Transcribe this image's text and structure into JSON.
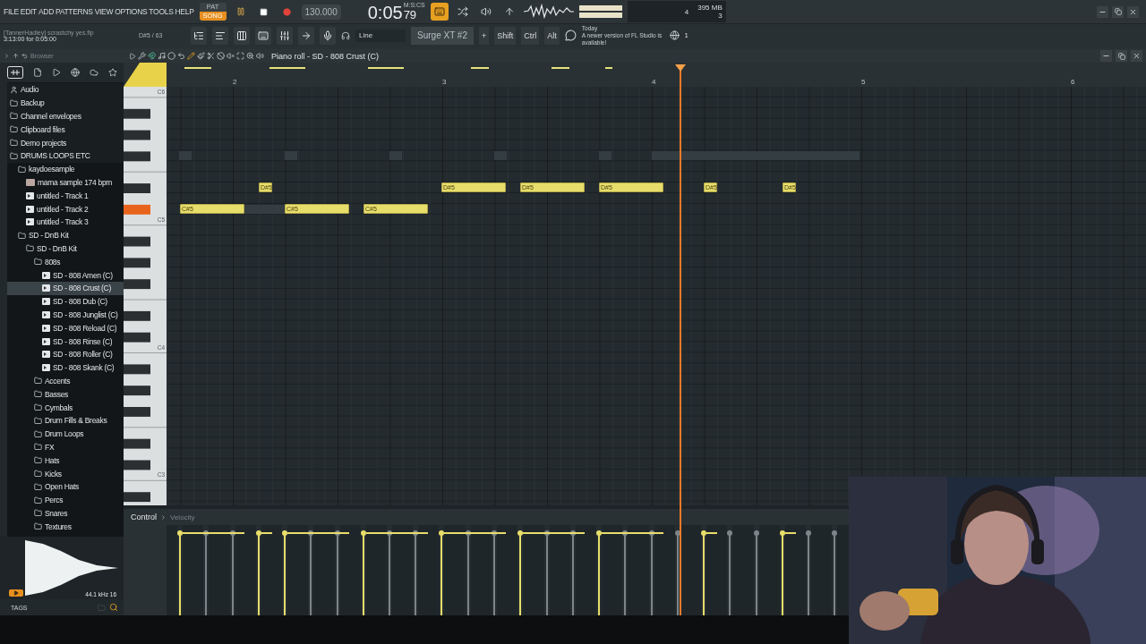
{
  "menu": [
    "FILE",
    "EDIT",
    "ADD",
    "PATTERNS",
    "VIEW",
    "OPTIONS",
    "TOOLS",
    "HELP"
  ],
  "transport": {
    "modes": [
      {
        "label": "PAT",
        "selected": false
      },
      {
        "label": "SONG",
        "selected": true
      }
    ],
    "tempo": "130.000",
    "time": "0:05",
    "time_fraction": "79",
    "time_unit": "M:S:CS"
  },
  "monitor": {
    "voices": "4",
    "memory": "395 MB",
    "cpu": "3"
  },
  "project": {
    "title": "[TannerHadley] scrastchy yes.flp",
    "position": "3:13:00 for 0:05:00",
    "note_info": "D#5 / 63"
  },
  "toolbar": {
    "recording_source": "Line",
    "channel": "Surge XT #2",
    "channel_add": "+",
    "modifiers": [
      "Shift",
      "Ctrl",
      "Alt"
    ],
    "hint_title": "Today",
    "hint": "A newer version of FL Studio is available!",
    "notification_count": "1"
  },
  "browser": {
    "title": "Browser",
    "tree": [
      {
        "label": "Audio",
        "kind": "user",
        "selected": false
      },
      {
        "label": "Backup",
        "kind": "folder",
        "selected": false
      },
      {
        "label": "Channel envelopes",
        "kind": "folder",
        "selected": false
      },
      {
        "label": "Clipboard files",
        "kind": "folder",
        "selected": false
      },
      {
        "label": "Demo projects",
        "kind": "folder",
        "selected": false
      },
      {
        "label": "DRUMS LOOPS ETC",
        "kind": "folder",
        "selected": false,
        "children": [
          {
            "label": "kaydoesample",
            "kind": "folder",
            "selected": false,
            "children": [
              {
                "label": "mama sample 174 bpm",
                "kind": "audio",
                "selected": false
              },
              {
                "label": "untitled - Track 1",
                "kind": "sample",
                "selected": false
              },
              {
                "label": "untitled - Track 2",
                "kind": "sample",
                "selected": false
              },
              {
                "label": "untitled - Track 3",
                "kind": "sample",
                "selected": false
              }
            ]
          },
          {
            "label": "SD - DnB Kit",
            "kind": "folder",
            "selected": false,
            "children": [
              {
                "label": "SD - DnB Kit",
                "kind": "folder",
                "selected": false,
                "children": [
                  {
                    "label": "808s",
                    "kind": "folder",
                    "selected": false,
                    "children": [
                      {
                        "label": "SD - 808 Amen (C)",
                        "kind": "sample",
                        "selected": false
                      },
                      {
                        "label": "SD - 808 Crust (C)",
                        "kind": "sample",
                        "selected": true
                      },
                      {
                        "label": "SD - 808 Dub (C)",
                        "kind": "sample",
                        "selected": false
                      },
                      {
                        "label": "SD - 808 Junglist (C)",
                        "kind": "sample",
                        "selected": false
                      },
                      {
                        "label": "SD - 808 Reload (C)",
                        "kind": "sample",
                        "selected": false
                      },
                      {
                        "label": "SD - 808 Rinse (C)",
                        "kind": "sample",
                        "selected": false
                      },
                      {
                        "label": "SD - 808 Roller (C)",
                        "kind": "sample",
                        "selected": false
                      },
                      {
                        "label": "SD - 808 Skank (C)",
                        "kind": "sample",
                        "selected": false
                      }
                    ]
                  },
                  {
                    "label": "Accents",
                    "kind": "folder",
                    "selected": false
                  },
                  {
                    "label": "Basses",
                    "kind": "folder",
                    "selected": false
                  },
                  {
                    "label": "Cymbals",
                    "kind": "folder",
                    "selected": false
                  },
                  {
                    "label": "Drum Fills & Breaks",
                    "kind": "folder",
                    "selected": false
                  },
                  {
                    "label": "Drum Loops",
                    "kind": "folder",
                    "selected": false
                  },
                  {
                    "label": "FX",
                    "kind": "folder",
                    "selected": false
                  },
                  {
                    "label": "Hats",
                    "kind": "folder",
                    "selected": false
                  },
                  {
                    "label": "Kicks",
                    "kind": "folder",
                    "selected": false
                  },
                  {
                    "label": "Open Hats",
                    "kind": "folder",
                    "selected": false
                  },
                  {
                    "label": "Percs",
                    "kind": "folder",
                    "selected": false
                  },
                  {
                    "label": "Snares",
                    "kind": "folder",
                    "selected": false
                  },
                  {
                    "label": "Textures",
                    "kind": "folder",
                    "selected": false
                  }
                ]
              }
            ]
          }
        ]
      }
    ],
    "waveform_info": "44.1 kHz 16",
    "tags_label": "TAGS"
  },
  "piano_roll": {
    "title": "Piano roll - SD - 808 Crust (C)",
    "ruler": [
      "2",
      "3",
      "4",
      "5",
      "6"
    ],
    "key_labels": [
      "C6",
      "C5",
      "C4",
      "C3"
    ],
    "notes": [
      {
        "label": "C#5",
        "level": 0.94
      },
      {
        "label": "D#5",
        "level": 0.94
      },
      {
        "label": "C#5",
        "level": 0.94
      },
      {
        "label": "C#5",
        "level": 0.94
      },
      {
        "label": "D#5",
        "level": 0.94
      },
      {
        "label": "D#5",
        "level": 0.94
      },
      {
        "label": "D#5",
        "level": 0.94
      },
      {
        "label": "D#5",
        "level": 0.94
      },
      {
        "label": "D#5",
        "level": 0.94
      }
    ],
    "control": "Control",
    "lane": "Velocity"
  },
  "webcam": {
    "kind": "picture"
  }
}
